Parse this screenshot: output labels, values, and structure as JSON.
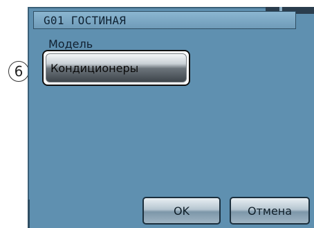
{
  "callout": {
    "number": "6"
  },
  "window": {
    "title": "G01 ГОСТИНАЯ"
  },
  "form": {
    "model_label": "Модель",
    "model_value": "Кондиционеры"
  },
  "buttons": {
    "ok_label": "OK",
    "cancel_label": "Отмена"
  },
  "colors": {
    "screen_bg": "#5f90b0",
    "titlebar_bg": "#8bb6d1"
  }
}
